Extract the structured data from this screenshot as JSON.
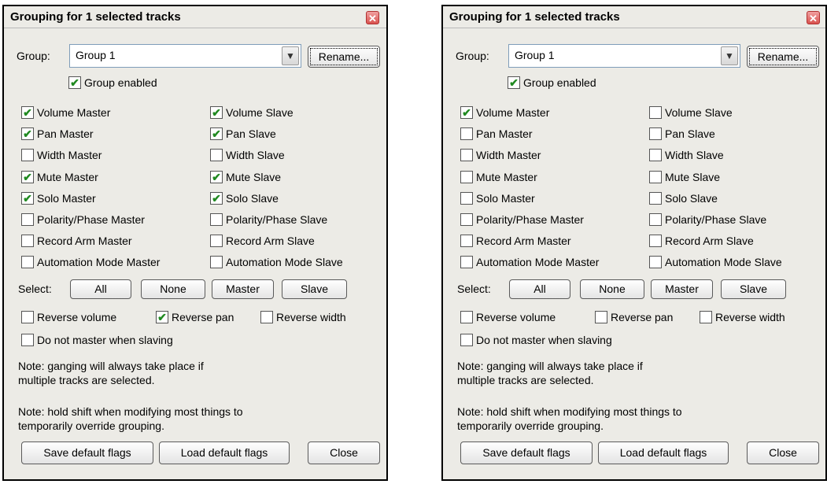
{
  "dialogs": [
    {
      "title": "Grouping for 1 selected tracks",
      "group_label": "Group:",
      "group_value": "Group 1",
      "rename": "Rename...",
      "group_enabled": {
        "label": "Group enabled",
        "checked": true
      },
      "flags": [
        {
          "label": "Volume Master",
          "checked": true
        },
        {
          "label": "Volume Slave",
          "checked": true
        },
        {
          "label": "Pan Master",
          "checked": true
        },
        {
          "label": "Pan Slave",
          "checked": true
        },
        {
          "label": "Width Master",
          "checked": false
        },
        {
          "label": "Width Slave",
          "checked": false
        },
        {
          "label": "Mute Master",
          "checked": true
        },
        {
          "label": "Mute Slave",
          "checked": true
        },
        {
          "label": "Solo Master",
          "checked": true
        },
        {
          "label": "Solo Slave",
          "checked": true
        },
        {
          "label": "Polarity/Phase Master",
          "checked": false
        },
        {
          "label": "Polarity/Phase Slave",
          "checked": false
        },
        {
          "label": "Record Arm Master",
          "checked": false
        },
        {
          "label": "Record Arm Slave",
          "checked": false
        },
        {
          "label": "Automation Mode Master",
          "checked": false
        },
        {
          "label": "Automation Mode Slave",
          "checked": false
        }
      ],
      "select_label": "Select:",
      "select_buttons": [
        "All",
        "None",
        "Master",
        "Slave"
      ],
      "reverse": [
        {
          "label": "Reverse volume",
          "checked": false
        },
        {
          "label": "Reverse pan",
          "checked": true
        },
        {
          "label": "Reverse width",
          "checked": false
        }
      ],
      "no_master": {
        "label": "Do not master when slaving",
        "checked": false
      },
      "note1": [
        "Note: ganging will always take place if",
        "multiple tracks are selected."
      ],
      "note2": [
        "Note: hold shift when modifying most things to",
        "temporarily override grouping."
      ],
      "bottom_buttons": [
        "Save default flags",
        "Load default flags",
        "Close"
      ]
    },
    {
      "title": "Grouping for 1 selected tracks",
      "group_label": "Group:",
      "group_value": "Group 1",
      "rename": "Rename...",
      "group_enabled": {
        "label": "Group enabled",
        "checked": true
      },
      "flags": [
        {
          "label": "Volume Master",
          "checked": true
        },
        {
          "label": "Volume Slave",
          "checked": false
        },
        {
          "label": "Pan Master",
          "checked": false
        },
        {
          "label": "Pan Slave",
          "checked": false
        },
        {
          "label": "Width Master",
          "checked": false
        },
        {
          "label": "Width Slave",
          "checked": false
        },
        {
          "label": "Mute Master",
          "checked": false
        },
        {
          "label": "Mute Slave",
          "checked": false
        },
        {
          "label": "Solo Master",
          "checked": false
        },
        {
          "label": "Solo Slave",
          "checked": false
        },
        {
          "label": "Polarity/Phase Master",
          "checked": false
        },
        {
          "label": "Polarity/Phase Slave",
          "checked": false
        },
        {
          "label": "Record Arm Master",
          "checked": false
        },
        {
          "label": "Record Arm Slave",
          "checked": false
        },
        {
          "label": "Automation Mode Master",
          "checked": false
        },
        {
          "label": "Automation Mode Slave",
          "checked": false
        }
      ],
      "select_label": "Select:",
      "select_buttons": [
        "All",
        "None",
        "Master",
        "Slave"
      ],
      "reverse": [
        {
          "label": "Reverse volume",
          "checked": false
        },
        {
          "label": "Reverse pan",
          "checked": false
        },
        {
          "label": "Reverse width",
          "checked": false
        }
      ],
      "no_master": {
        "label": "Do not master when slaving",
        "checked": false
      },
      "note1": [
        "Note: ganging will always take place if",
        "multiple tracks are selected."
      ],
      "note2": [
        "Note: hold shift when modifying most things to",
        "temporarily override grouping."
      ],
      "bottom_buttons": [
        "Save default flags",
        "Load default flags",
        "Close"
      ]
    }
  ]
}
